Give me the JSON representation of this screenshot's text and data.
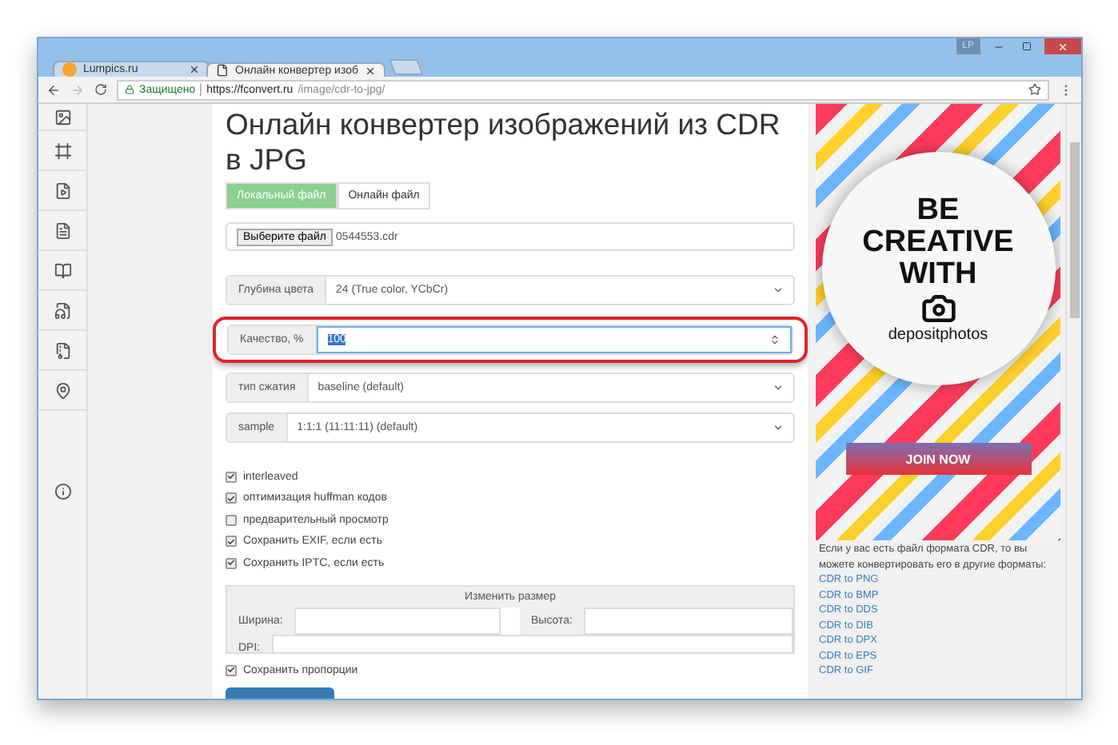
{
  "browser": {
    "tabs": [
      {
        "label": "Lumpics.ru",
        "selected": false
      },
      {
        "label": "Онлайн конвертер изоб",
        "selected": true
      }
    ],
    "profile_badge": "LP",
    "security_label": "Защищено",
    "url_host": "https://fconvert.ru",
    "url_path": "/image/cdr-to-jpg/"
  },
  "page": {
    "title": "Онлайн конвертер изображений из CDR в JPG",
    "source_tabs": [
      {
        "label": "Локальный файл",
        "selected": true
      },
      {
        "label": "Онлайн файл",
        "selected": false
      }
    ],
    "file": {
      "button": "Выберите файл",
      "name": "0544553.cdr"
    },
    "settings": [
      {
        "kind": "select",
        "label": "Глубина цвета",
        "value": "24 (True color, YCbCr)",
        "highlighted": false
      },
      {
        "kind": "number",
        "label": "Качество, %",
        "value": "100",
        "highlighted": true
      },
      {
        "kind": "select",
        "label": "тип сжатия",
        "value": "baseline (default)",
        "highlighted": false
      },
      {
        "kind": "select",
        "label": "sample",
        "value": "1:1:1 (11:11:11) (default)",
        "highlighted": false
      }
    ],
    "options": [
      {
        "label": "interleaved",
        "checked": true
      },
      {
        "label": "оптимизация huffman кодов",
        "checked": true
      },
      {
        "label": "предварительный просмотр",
        "checked": false
      },
      {
        "label": "Сохранить EXIF, если есть",
        "checked": true
      },
      {
        "label": "Сохранить IPTC, если есть",
        "checked": true
      }
    ],
    "resize": {
      "title": "Изменить размер",
      "width_label": "Ширина:",
      "height_label": "Высота:",
      "dpi_label": "DPI:"
    },
    "keep_proportions": {
      "label": "Сохранить пропорции",
      "checked": true
    }
  },
  "ad": {
    "headline": [
      "BE",
      "CREATIVE",
      "WITH"
    ],
    "brand": "depositphotos",
    "cta": "JOIN NOW"
  },
  "formats": {
    "intro": "Если у вас есть файл формата CDR, то вы можете конвертировать его в другие форматы:",
    "links": [
      "CDR to PNG",
      "CDR to BMP",
      "CDR to DDS",
      "CDR to DIB",
      "CDR to DPX",
      "CDR to EPS",
      "CDR to GIF"
    ]
  }
}
